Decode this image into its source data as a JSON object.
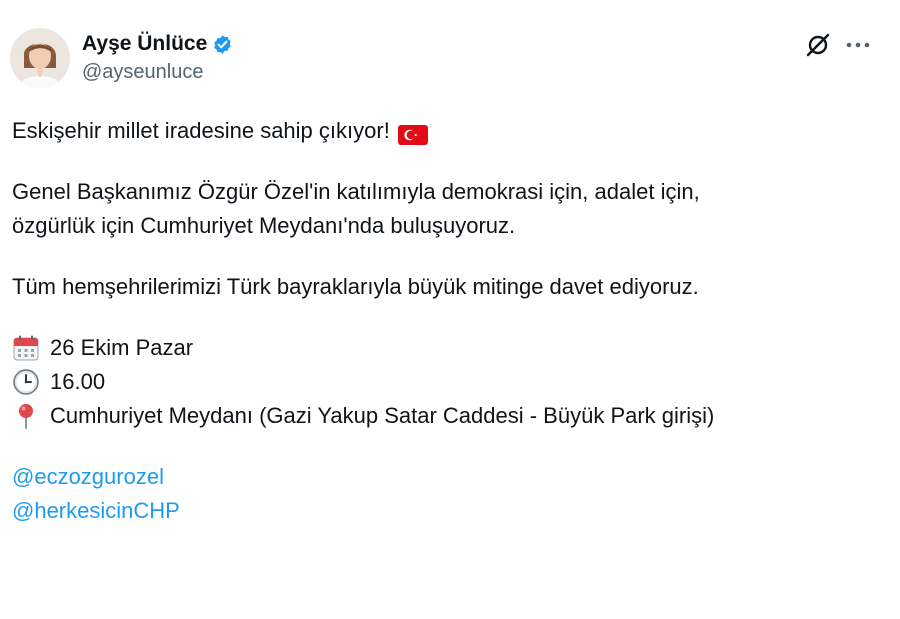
{
  "author": {
    "name": "Ayşe Ünlüce",
    "handle": "@ayseunluce"
  },
  "tweet": {
    "line1": "Eskişehir millet iradesine sahip çıkıyor!",
    "line2": "Genel Başkanımız Özgür Özel'in katılımıyla demokrasi için, adalet için,",
    "line3": "özgürlük için Cumhuriyet Meydanı'nda buluşuyoruz.",
    "line4": "Tüm hemşehrilerimizi Türk bayraklarıyla büyük mitinge davet ediyoruz.",
    "date": "26 Ekim Pazar",
    "time": "16.00",
    "location": "Cumhuriyet Meydanı (Gazi Yakup Satar Caddesi - Büyük Park girişi)",
    "mentions": [
      "@eczozgurozel",
      "@herkesicinCHP"
    ]
  },
  "icons": {
    "verified": "verified-badge-icon",
    "grok": "grok-icon",
    "more": "more-icon",
    "flag": "turkish-flag-emoji",
    "calendar": "calendar-emoji",
    "clock": "clock-emoji",
    "pin": "round-pushpin-emoji"
  },
  "colors": {
    "accent": "#1d9bf0",
    "text": "#0f1419",
    "muted": "#536471",
    "flag_red": "#e30a17"
  }
}
